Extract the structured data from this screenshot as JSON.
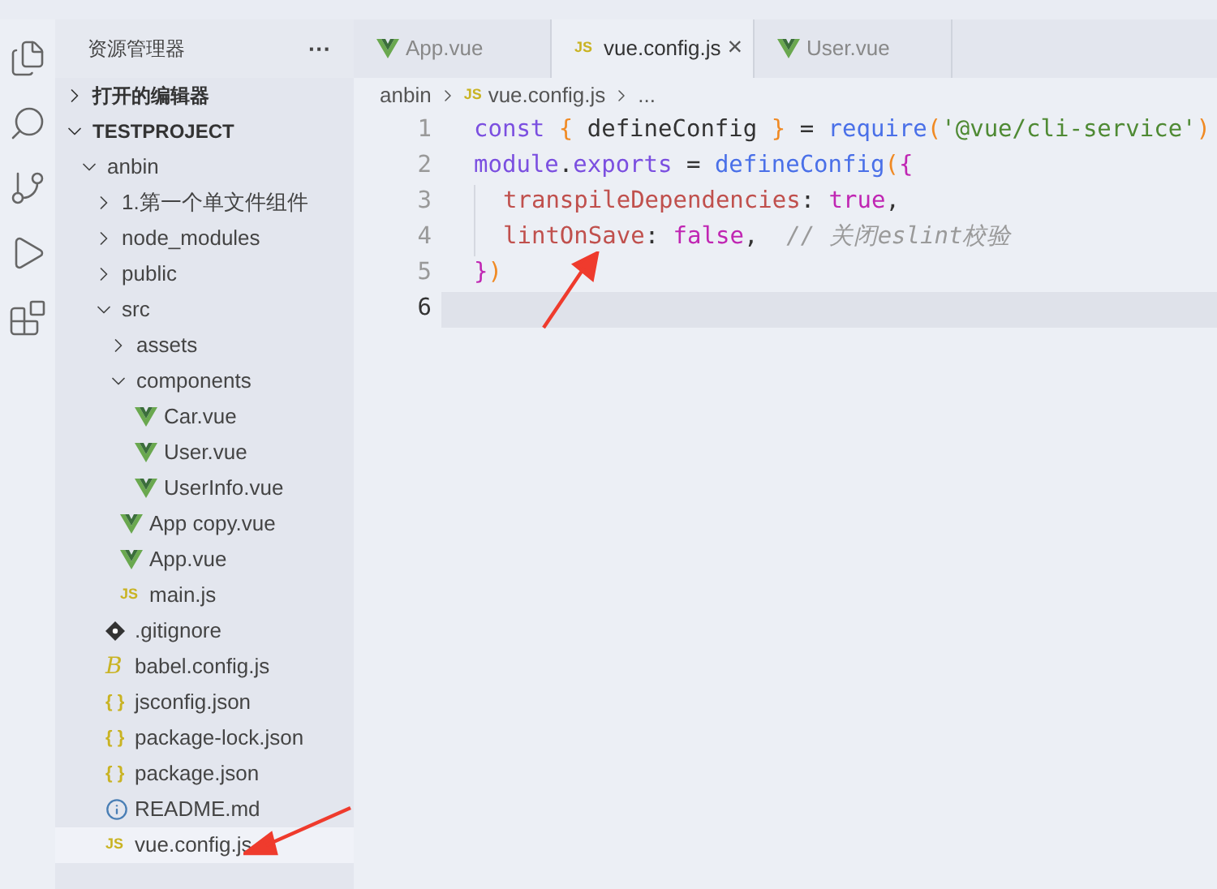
{
  "sidebar": {
    "title": "资源管理器",
    "more": "···",
    "sections": [
      {
        "label": "打开的编辑器",
        "expanded": false
      },
      {
        "label": "TESTPROJECT",
        "expanded": true
      }
    ],
    "tree": [
      {
        "kind": "folder",
        "label": "anbin",
        "expanded": true,
        "selected": false,
        "children": [
          {
            "kind": "folder",
            "label": "1.第一个单文件组件",
            "expanded": false,
            "selected": false
          },
          {
            "kind": "folder",
            "label": "node_modules",
            "expanded": false,
            "selected": false
          },
          {
            "kind": "folder",
            "label": "public",
            "expanded": false,
            "selected": false
          },
          {
            "kind": "folder",
            "label": "src",
            "expanded": true,
            "selected": false,
            "children": [
              {
                "kind": "folder",
                "label": "assets",
                "expanded": false,
                "selected": false
              },
              {
                "kind": "folder",
                "label": "components",
                "expanded": true,
                "selected": false,
                "children": [
                  {
                    "kind": "vue",
                    "label": "Car.vue",
                    "selected": false
                  },
                  {
                    "kind": "vue",
                    "label": "User.vue",
                    "selected": false
                  },
                  {
                    "kind": "vue",
                    "label": "UserInfo.vue",
                    "selected": false
                  }
                ]
              },
              {
                "kind": "vue",
                "label": "App copy.vue",
                "selected": false
              },
              {
                "kind": "vue",
                "label": "App.vue",
                "selected": false
              },
              {
                "kind": "js",
                "badge": "JS",
                "label": "main.js",
                "selected": false
              }
            ]
          },
          {
            "kind": "git",
            "label": ".gitignore",
            "selected": false
          },
          {
            "kind": "babel",
            "badge": "B",
            "label": "babel.config.js",
            "selected": false
          },
          {
            "kind": "json",
            "badge": "{ }",
            "label": "jsconfig.json",
            "selected": false
          },
          {
            "kind": "json",
            "badge": "{ }",
            "label": "package-lock.json",
            "selected": false
          },
          {
            "kind": "json",
            "badge": "{ }",
            "label": "package.json",
            "selected": false
          },
          {
            "kind": "info",
            "label": "README.md",
            "selected": false
          },
          {
            "kind": "js",
            "badge": "JS",
            "label": "vue.config.js",
            "selected": true
          }
        ]
      }
    ]
  },
  "tabs": [
    {
      "kind": "vue",
      "label": "App.vue",
      "selected": false
    },
    {
      "kind": "js",
      "badge": "JS",
      "label": "vue.config.js",
      "selected": true,
      "close": "×"
    },
    {
      "kind": "vue",
      "label": "User.vue",
      "selected": false
    }
  ],
  "breadcrumb": [
    {
      "label": "anbin"
    },
    {
      "badge": "JS",
      "label": "vue.config.js"
    },
    {
      "label": "..."
    }
  ],
  "editor": {
    "lines": [
      {
        "number": "1",
        "current": false,
        "tokens": [
          {
            "kind": "keyword",
            "text": "const "
          },
          {
            "kind": "brace",
            "text": "{ "
          },
          {
            "kind": "ident",
            "text": "defineConfig "
          },
          {
            "kind": "brace",
            "text": "}"
          },
          {
            "kind": "ident",
            "text": " = "
          },
          {
            "kind": "func",
            "text": "require"
          },
          {
            "kind": "brace",
            "text": "("
          },
          {
            "kind": "string",
            "text": "'@vue/cli-service'"
          },
          {
            "kind": "brace",
            "text": ")"
          }
        ]
      },
      {
        "number": "2",
        "current": false,
        "tokens": [
          {
            "kind": "keyword",
            "text": "module"
          },
          {
            "kind": "ident",
            "text": "."
          },
          {
            "kind": "keyword",
            "text": "exports"
          },
          {
            "kind": "ident",
            "text": " = "
          },
          {
            "kind": "func",
            "text": "defineConfig"
          },
          {
            "kind": "brace",
            "text": "("
          },
          {
            "kind": "bracket",
            "text": "{"
          }
        ]
      },
      {
        "number": "3",
        "current": false,
        "indent": true,
        "tokens": [
          {
            "kind": "prop",
            "text": "transpileDependencies"
          },
          {
            "kind": "ident",
            "text": ": "
          },
          {
            "kind": "bool",
            "text": "true"
          },
          {
            "kind": "ident",
            "text": ","
          }
        ]
      },
      {
        "number": "4",
        "current": false,
        "indent": true,
        "tokens": [
          {
            "kind": "prop",
            "text": "lintOnSave"
          },
          {
            "kind": "ident",
            "text": ": "
          },
          {
            "kind": "bool",
            "text": "false"
          },
          {
            "kind": "ident",
            "text": ",  "
          },
          {
            "kind": "comment",
            "text": "// 关闭eslint校验"
          }
        ]
      },
      {
        "number": "5",
        "current": false,
        "tokens": [
          {
            "kind": "bracket",
            "text": "}"
          },
          {
            "kind": "brace",
            "text": ")"
          }
        ]
      },
      {
        "number": "6",
        "current": true
      }
    ]
  }
}
